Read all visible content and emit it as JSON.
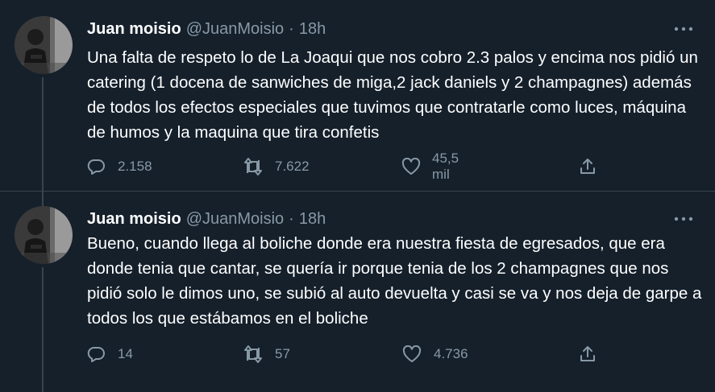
{
  "colors": {
    "background": "#15202b",
    "text_primary": "#ffffff",
    "text_secondary": "#8899a6",
    "divider": "#38444d"
  },
  "tweets": [
    {
      "author_name": "Juan moisio",
      "handle": "@JuanMoisio",
      "separator": "·",
      "time": "18h",
      "text": "Una falta de respeto lo de La Joaqui que nos cobro 2.3 palos y encima nos pidió un catering (1 docena de sanwiches de miga,2 jack daniels y 2 champagnes) además de todos los efectos especiales que tuvimos que contratarle como luces, máquina de humos y la maquina que tira confetis",
      "replies": "2.158",
      "retweets": "7.622",
      "likes": "45,5 mil",
      "icons": [
        "reply-icon",
        "retweet-icon",
        "like-icon",
        "share-icon",
        "more-icon"
      ]
    },
    {
      "author_name": "Juan moisio",
      "handle": "@JuanMoisio",
      "separator": "·",
      "time": "18h",
      "text": "Bueno, cuando llega al boliche donde era nuestra fiesta de egresados, que era donde tenia que cantar, se quería ir porque tenia de los 2 champagnes que nos pidió solo le dimos uno, se subió al auto devuelta y casi se va y nos deja de garpe a todos los que estábamos en el boliche",
      "replies": "14",
      "retweets": "57",
      "likes": "4.736",
      "icons": [
        "reply-icon",
        "retweet-icon",
        "like-icon",
        "share-icon",
        "more-icon"
      ]
    }
  ]
}
